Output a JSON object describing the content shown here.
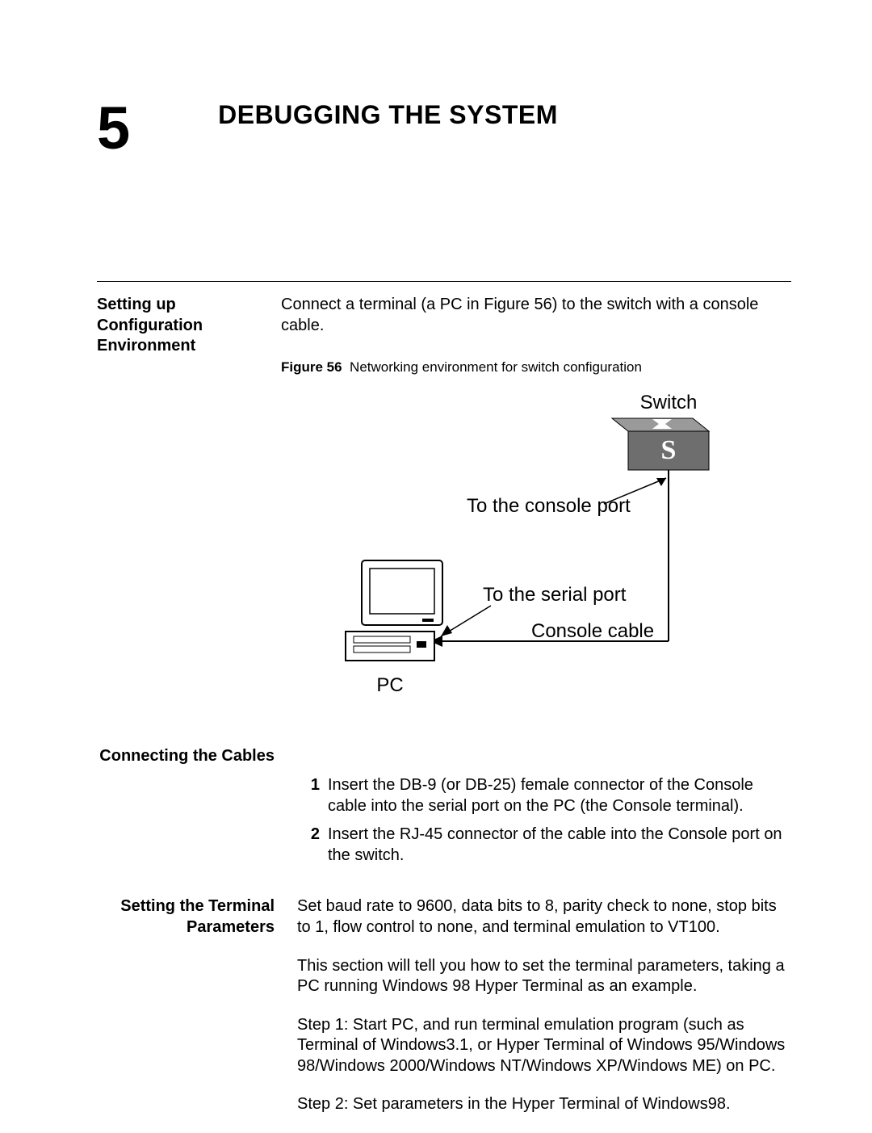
{
  "chapter": {
    "number": "5",
    "title": "DEBUGGING THE SYSTEM"
  },
  "section1": {
    "heading": "Setting up Configuration Environment",
    "intro": "Connect a terminal (a PC in Figure 56) to the switch with a console cable.",
    "figure_label": "Figure 56",
    "figure_caption": "Networking environment for switch configuration"
  },
  "figure": {
    "switch_label": "Switch",
    "switch_glyph": "S",
    "console_port_label": "To the console port",
    "serial_port_label": "To the serial port",
    "cable_label": "Console cable",
    "pc_label": "PC"
  },
  "section2": {
    "heading": "Connecting the Cables",
    "items": [
      {
        "num": "1",
        "text": "Insert the DB-9 (or DB-25) female connector of the Console cable into the serial port on the PC (the Console terminal)."
      },
      {
        "num": "2",
        "text": "Insert the RJ-45 connector of the cable into the Console port on the switch."
      }
    ]
  },
  "section3": {
    "heading": "Setting the Terminal Parameters",
    "para1": "Set baud rate to 9600, data bits to 8, parity check to none, stop bits to 1, flow control to none, and terminal emulation to VT100.",
    "para2": "This section will tell you how to set the terminal parameters, taking a PC running Windows 98 Hyper Terminal as an example.",
    "para3": "Step 1: Start PC, and run terminal emulation program (such as Terminal of Windows3.1, or Hyper Terminal of Windows 95/Windows 98/Windows 2000/Windows NT/Windows XP/Windows ME) on PC.",
    "para4": "Step 2: Set parameters in the Hyper Terminal of Windows98."
  }
}
